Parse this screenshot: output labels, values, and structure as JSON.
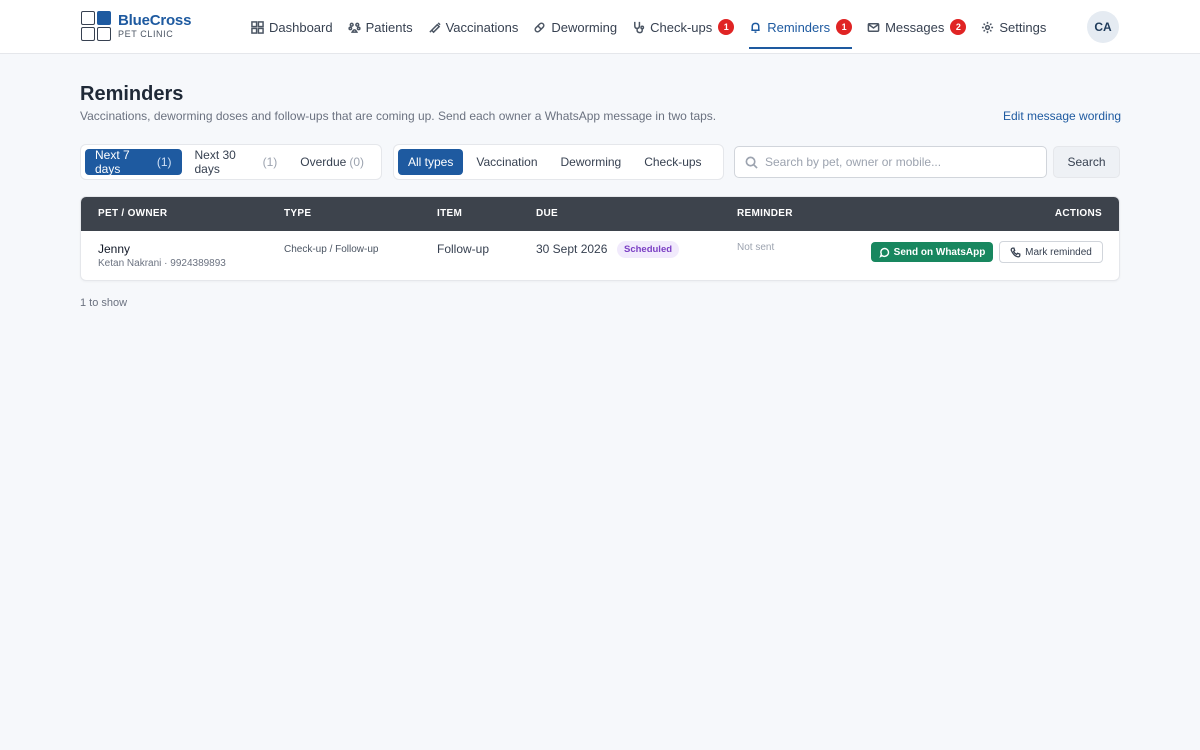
{
  "brand": {
    "name": "BlueCross",
    "sub": "PET CLINIC"
  },
  "nav": {
    "items": [
      {
        "label": "Dashboard",
        "icon": "grid-icon"
      },
      {
        "label": "Patients",
        "icon": "paw-icon"
      },
      {
        "label": "Vaccinations",
        "icon": "syringe-icon"
      },
      {
        "label": "Deworming",
        "icon": "pill-icon"
      },
      {
        "label": "Check-ups",
        "icon": "stethoscope-icon",
        "badge": "1"
      },
      {
        "label": "Reminders",
        "icon": "bell-icon",
        "badge": "1",
        "active": true
      },
      {
        "label": "Messages",
        "icon": "mail-icon",
        "badge": "2"
      },
      {
        "label": "Settings",
        "icon": "gear-icon"
      }
    ]
  },
  "user": {
    "initials": "CA"
  },
  "page": {
    "title": "Reminders",
    "subtitle": "Vaccinations, deworming doses and follow-ups that are coming up. Send each owner a WhatsApp message in two taps.",
    "edit_link": "Edit message wording"
  },
  "filters": {
    "range": [
      {
        "label": "Next 7 days",
        "count": "(1)",
        "active": true
      },
      {
        "label": "Next 30 days",
        "count": "(1)"
      },
      {
        "label": "Overdue",
        "count": "(0)"
      }
    ],
    "types": [
      {
        "label": "All types",
        "active": true
      },
      {
        "label": "Vaccination"
      },
      {
        "label": "Deworming"
      },
      {
        "label": "Check-ups"
      }
    ],
    "search_placeholder": "Search by pet, owner or mobile...",
    "search_button": "Search"
  },
  "table": {
    "headers": {
      "pet_owner": "PET / OWNER",
      "type": "TYPE",
      "item": "ITEM",
      "due": "DUE",
      "reminder": "REMINDER",
      "actions": "ACTIONS"
    },
    "rows": [
      {
        "pet": "Jenny",
        "owner": "Ketan Nakrani · 9924389893",
        "type": "Check-up / Follow-up",
        "item": "Follow-up",
        "due": "30 Sept 2026",
        "status": "Scheduled",
        "reminder": "Not sent",
        "whatsapp_label": "Send on WhatsApp",
        "mark_label": "Mark reminded"
      }
    ]
  },
  "footer": {
    "count_text": "1 to show"
  },
  "colors": {
    "brand": "#1e5aa0",
    "header_bg": "#3d434c",
    "whatsapp": "#18875f",
    "badge": "#e02424",
    "scheduled_bg": "#f1eafc",
    "scheduled_text": "#7b3fc4"
  }
}
